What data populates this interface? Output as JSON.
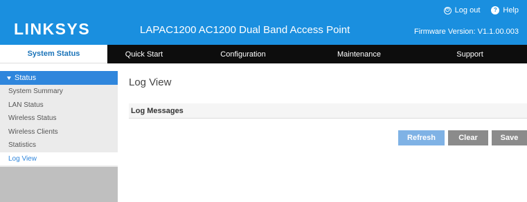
{
  "header": {
    "logo": "LINKSYS",
    "product_name": "LAPAC1200 AC1200 Dual Band Access Point",
    "logout_label": "Log out",
    "help_label": "Help",
    "firmware_version": "Firmware Version: V1.1.00.003",
    "colors": {
      "header_bg": "#1a8fdf",
      "nav_bg": "#0d0d0d"
    }
  },
  "nav": {
    "tabs": [
      {
        "label": "System Status",
        "active": true
      },
      {
        "label": "Quick Start"
      },
      {
        "label": "Configuration"
      },
      {
        "label": "Maintenance"
      },
      {
        "label": "Support"
      }
    ]
  },
  "sidebar": {
    "section_label": "Status",
    "items": [
      {
        "label": "System Summary"
      },
      {
        "label": "LAN Status"
      },
      {
        "label": "Wireless Status"
      },
      {
        "label": "Wireless Clients"
      },
      {
        "label": "Statistics"
      },
      {
        "label": "Log View",
        "active": true
      }
    ]
  },
  "main": {
    "page_title": "Log View",
    "panel_title": "Log Messages",
    "buttons": {
      "refresh": "Refresh",
      "clear": "Clear",
      "save": "Save"
    }
  }
}
